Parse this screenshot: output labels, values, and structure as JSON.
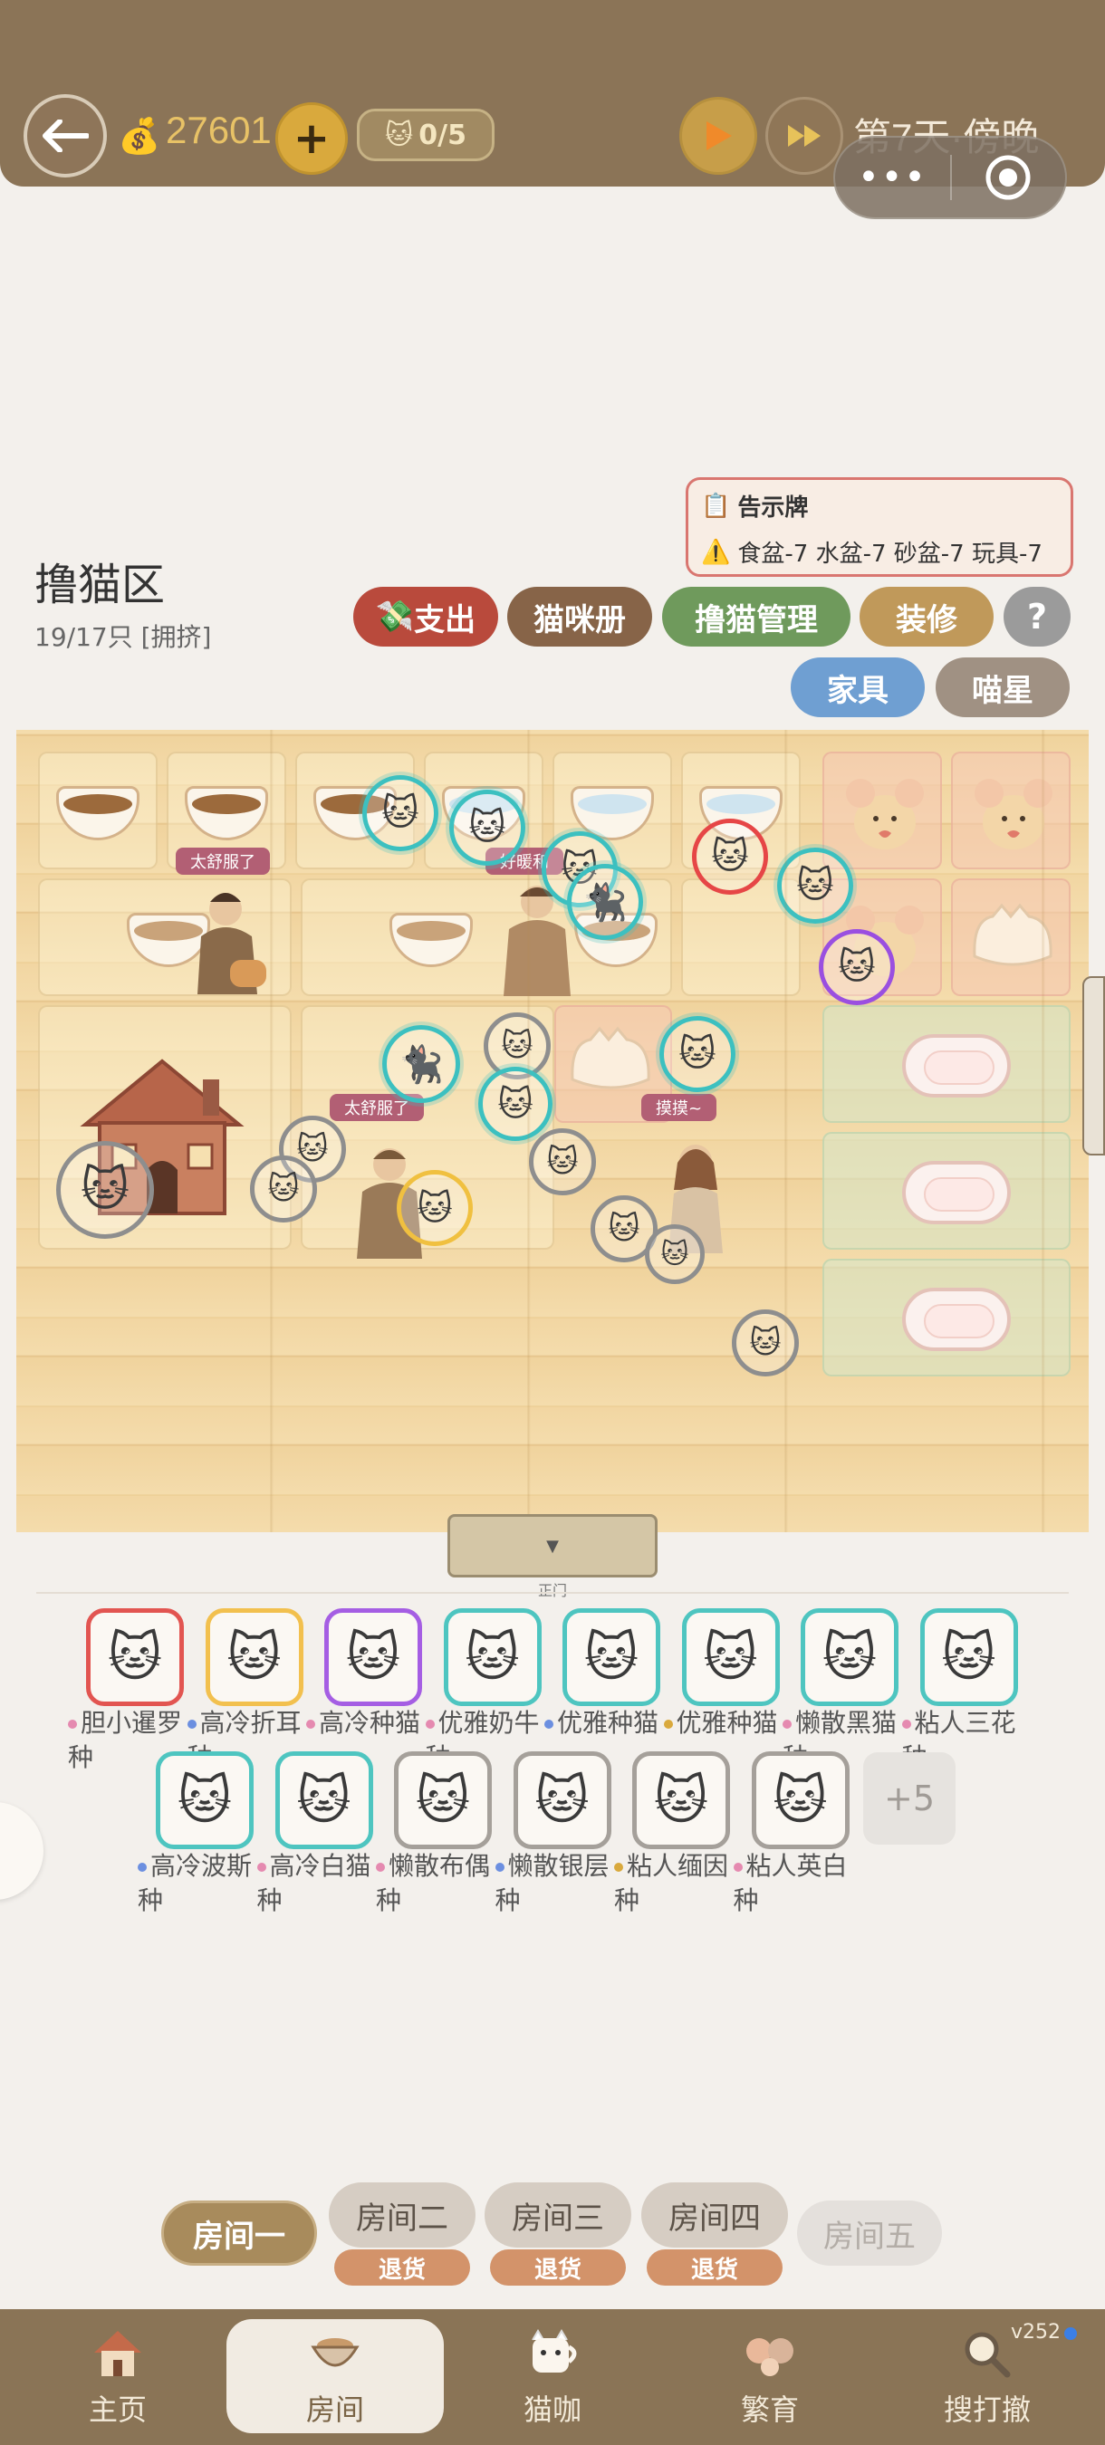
{
  "header": {
    "coins": "27601",
    "capacity": "0/5",
    "day_label": "第7天·傍晚"
  },
  "area": {
    "title": "撸猫区",
    "count": "19/17只 [拥挤]"
  },
  "notice": {
    "title": "告示牌",
    "body": "食盆-7 水盆-7 砂盆-7 玩具-7"
  },
  "toolbar": {
    "expense": "支出",
    "catbook": "猫咪册",
    "manage": "撸猫管理",
    "decorate": "装修",
    "help": "?",
    "furniture": "家具",
    "meow_star": "喵星"
  },
  "scene": {
    "bubbles": [
      "太舒服了",
      "好暖和",
      "太舒服了",
      "摸摸~"
    ],
    "gate_label": "正门"
  },
  "roster": [
    {
      "name": "胆小暹罗种",
      "border": "red"
    },
    {
      "name": "高冷折耳种",
      "border": "yellow"
    },
    {
      "name": "高冷种猫",
      "border": "purple"
    },
    {
      "name": "优雅奶牛种",
      "border": "teal"
    },
    {
      "name": "优雅种猫",
      "border": "teal"
    },
    {
      "name": "优雅种猫",
      "border": "teal"
    },
    {
      "name": "懒散黑猫种",
      "border": "teal"
    },
    {
      "name": "粘人三花种",
      "border": "teal"
    },
    {
      "name": "高冷波斯种",
      "border": "teal"
    },
    {
      "name": "高冷白猫种",
      "border": "teal"
    },
    {
      "name": "懒散布偶种",
      "border": "gray"
    },
    {
      "name": "懒散银层种",
      "border": "gray"
    },
    {
      "name": "粘人缅因种",
      "border": "gray"
    },
    {
      "name": "粘人英白种",
      "border": "gray"
    }
  ],
  "roster_more": "+5",
  "rooms": [
    {
      "label": "房间一",
      "state": "active"
    },
    {
      "label": "房间二",
      "state": "normal",
      "refund": "退货"
    },
    {
      "label": "房间三",
      "state": "normal",
      "refund": "退货"
    },
    {
      "label": "房间四",
      "state": "normal",
      "refund": "退货"
    },
    {
      "label": "房间五",
      "state": "disabled"
    }
  ],
  "nav": {
    "items": [
      "主页",
      "房间",
      "猫咖",
      "繁育",
      "搜打撤"
    ],
    "active": "房间",
    "version": "v252"
  },
  "colors": {
    "topbar": "#8b7457",
    "accent_gold": "#d9a93d",
    "teal": "#4ec5c0",
    "red": "#e25551",
    "purple": "#a55ee3",
    "gray": "#a5a09a"
  }
}
